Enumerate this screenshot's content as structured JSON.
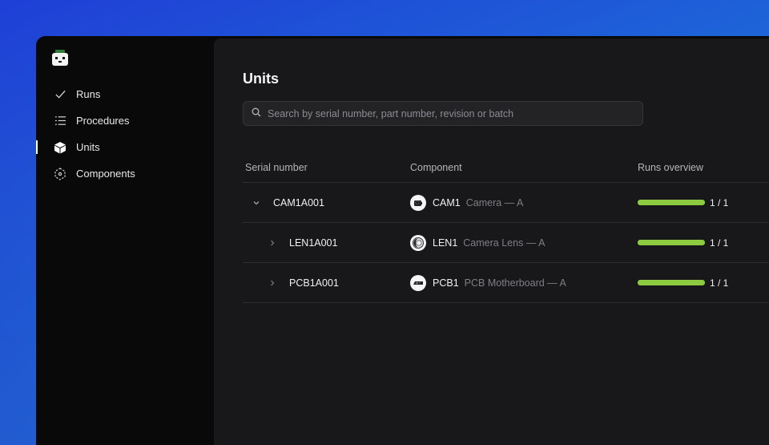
{
  "sidebar": {
    "items": [
      {
        "label": "Runs",
        "icon": "check-icon"
      },
      {
        "label": "Procedures",
        "icon": "list-icon"
      },
      {
        "label": "Units",
        "icon": "cube-icon",
        "active": true
      },
      {
        "label": "Components",
        "icon": "components-icon"
      }
    ]
  },
  "main": {
    "title": "Units",
    "search": {
      "placeholder": "Search by serial number, part number, revision or batch",
      "value": ""
    }
  },
  "table": {
    "headers": [
      "Serial number",
      "Component",
      "Runs overview"
    ],
    "rows": [
      {
        "serial": "CAM1A001",
        "part": "CAM1",
        "desc": "Camera — A",
        "runs": "1 / 1",
        "progress": 1.0,
        "expanded": true
      },
      {
        "serial": "LEN1A001",
        "part": "LEN1",
        "desc": "Camera Lens — A",
        "runs": "1 / 1",
        "progress": 1.0
      },
      {
        "serial": "PCB1A001",
        "part": "PCB1",
        "desc": "PCB Motherboard — A",
        "runs": "1 / 1",
        "progress": 1.0
      }
    ]
  },
  "colors": {
    "progress": "#8ccb3f",
    "accent_bg": "#1f3fd6"
  }
}
